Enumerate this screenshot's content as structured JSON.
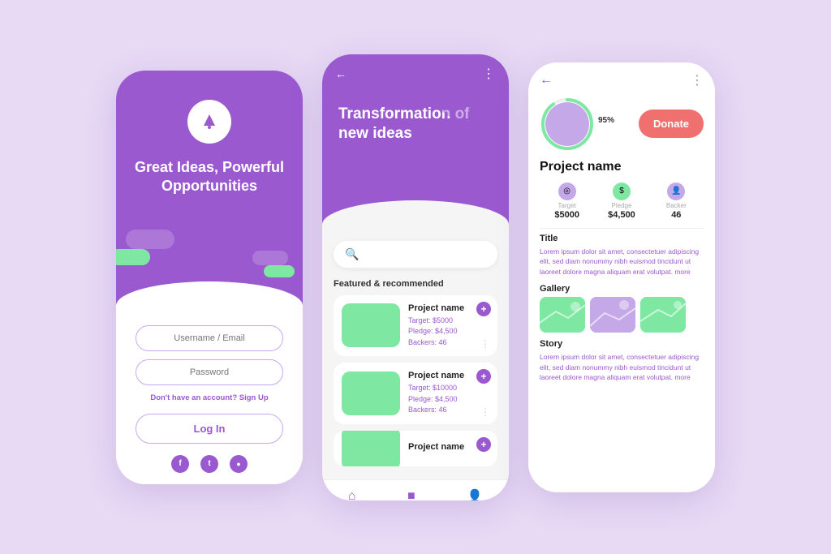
{
  "screen1": {
    "title": "Great Ideas, Powerful Opportunities",
    "username_placeholder": "Username / Email",
    "password_placeholder": "Password",
    "signup_text": "Don't have an account?",
    "signup_link": "Sign Up",
    "login_btn": "Log In",
    "social": [
      "f",
      "t",
      "in"
    ]
  },
  "screen2": {
    "header_title": "Transformation of new ideas",
    "section_label": "Featured & recommended",
    "search_placeholder": "",
    "cards": [
      {
        "name": "Project name",
        "target": "$5000",
        "pledge": "$4,500",
        "backers": "46"
      },
      {
        "name": "Project name",
        "target": "$10000",
        "pledge": "$4,500",
        "backers": "46"
      },
      {
        "name": "Project name",
        "target": "",
        "pledge": "",
        "backers": ""
      }
    ]
  },
  "screen3": {
    "project_name": "Project name",
    "percent": "95%",
    "donate_btn": "Donate",
    "stats": {
      "target_label": "Target",
      "target_value": "$5000",
      "pledge_label": "Pledge",
      "pledge_value": "$4,500",
      "backer_label": "Backer",
      "backer_value": "46"
    },
    "title_section": "Title",
    "title_text": "Lorem ipsum dolor sit amet, consectetuer adipiscing elit, sed diam nonummy nibh euismod tincidunt ut laoreet dolore magna aliquam erat volutpat.",
    "title_more": "more",
    "gallery_label": "Gallery",
    "story_label": "Story",
    "story_text": "Lorem ipsum dolor sit amet, consectetuer adipiscing elit, sed diam nonummy nibh euismod tincidunt ut laoreet dolore magna aliquam erat volutpat.",
    "story_more": "more"
  },
  "colors": {
    "purple": "#9b59d0",
    "green": "#7ee8a2",
    "avatar_bg": "#c5a8e8",
    "donate_btn": "#f07070",
    "bg": "#e8d9f5"
  }
}
